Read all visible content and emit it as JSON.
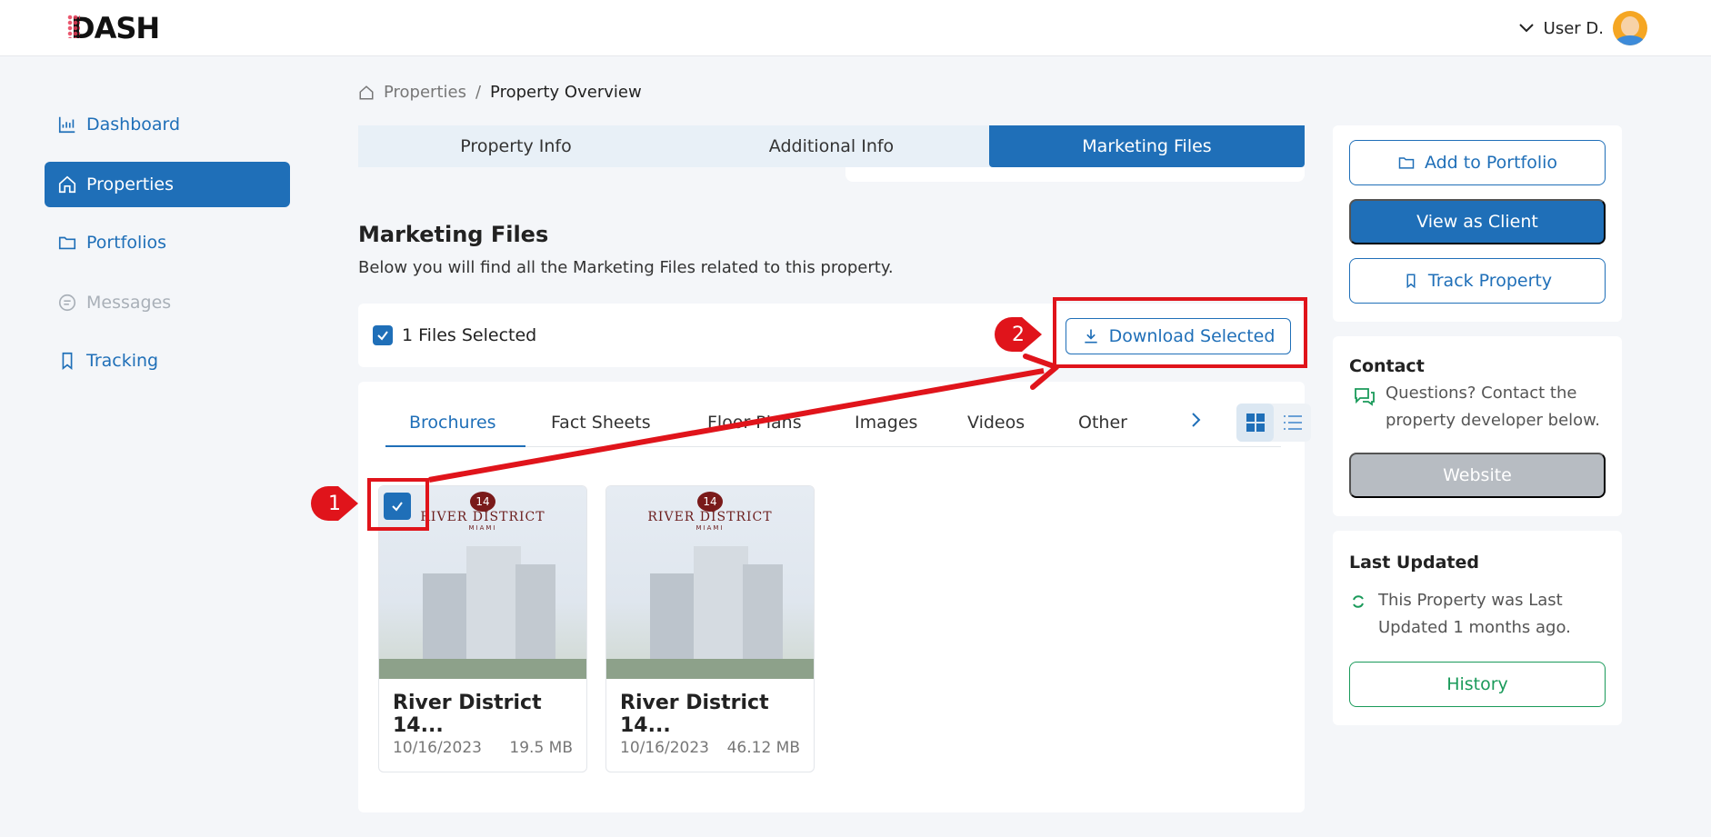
{
  "app": {
    "logo": "DASH"
  },
  "user": {
    "name": "User D."
  },
  "sidebar": {
    "items": [
      {
        "label": "Dashboard",
        "state": "normal"
      },
      {
        "label": "Properties",
        "state": "active"
      },
      {
        "label": "Portfolios",
        "state": "normal"
      },
      {
        "label": "Messages",
        "state": "disabled"
      },
      {
        "label": "Tracking",
        "state": "normal"
      }
    ]
  },
  "breadcrumb": {
    "root": "Properties",
    "separator": "/",
    "current": "Property Overview"
  },
  "tabs": [
    {
      "label": "Property Info",
      "active": false
    },
    {
      "label": "Additional Info",
      "active": false
    },
    {
      "label": "Marketing Files",
      "active": true
    }
  ],
  "section": {
    "title": "Marketing Files",
    "subtitle": "Below you will find all the Marketing Files related to this property."
  },
  "selection": {
    "label": "1 Files Selected",
    "download_label": "Download Selected"
  },
  "file_tabs": [
    "Brochures",
    "Fact Sheets",
    "Floor Plans",
    "Images",
    "Videos",
    "Other"
  ],
  "files": [
    {
      "name": "River District 14...",
      "date": "10/16/2023",
      "size": "19.5 MB",
      "selected": true,
      "brand": "RIVER DISTRICT",
      "badge": "14",
      "brand_sub": "MIAMI"
    },
    {
      "name": "River District 14...",
      "date": "10/16/2023",
      "size": "46.12 MB",
      "selected": false,
      "brand": "RIVER DISTRICT",
      "badge": "14",
      "brand_sub": "MIAMI"
    }
  ],
  "actions": {
    "add_portfolio": "Add to Portfolio",
    "view_client": "View as Client",
    "track": "Track Property"
  },
  "contact": {
    "title": "Contact",
    "text_line1": "Questions? Contact the",
    "text_line2": "property developer below.",
    "website": "Website"
  },
  "last_updated": {
    "title": "Last Updated",
    "text_line1": "This Property was Last",
    "text_line2": "Updated 1 months ago.",
    "history": "History"
  },
  "annotations": {
    "step1": "1",
    "step2": "2"
  },
  "colors": {
    "primary": "#1f6fb8",
    "annotation": "#e0141b",
    "success": "#1a9a5a"
  }
}
